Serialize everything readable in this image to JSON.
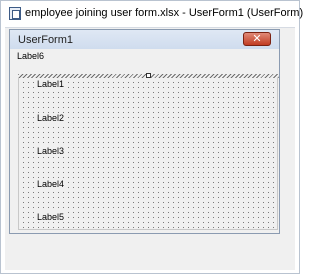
{
  "window": {
    "title": "employee joining user form.xlsx - UserForm1 (UserForm)",
    "icon": "vbe-userform-icon"
  },
  "userform": {
    "caption": "UserForm1",
    "close_glyph": "✕",
    "top_label": "Label6",
    "frame_labels": [
      "Label1",
      "Label2",
      "Label3",
      "Label4",
      "Label5"
    ]
  },
  "colors": {
    "designer_background": "#f0f0f0",
    "titlebar_gradient": [
      "#dfe8f4",
      "#cfdcee"
    ],
    "close_button": "#c13c22"
  }
}
